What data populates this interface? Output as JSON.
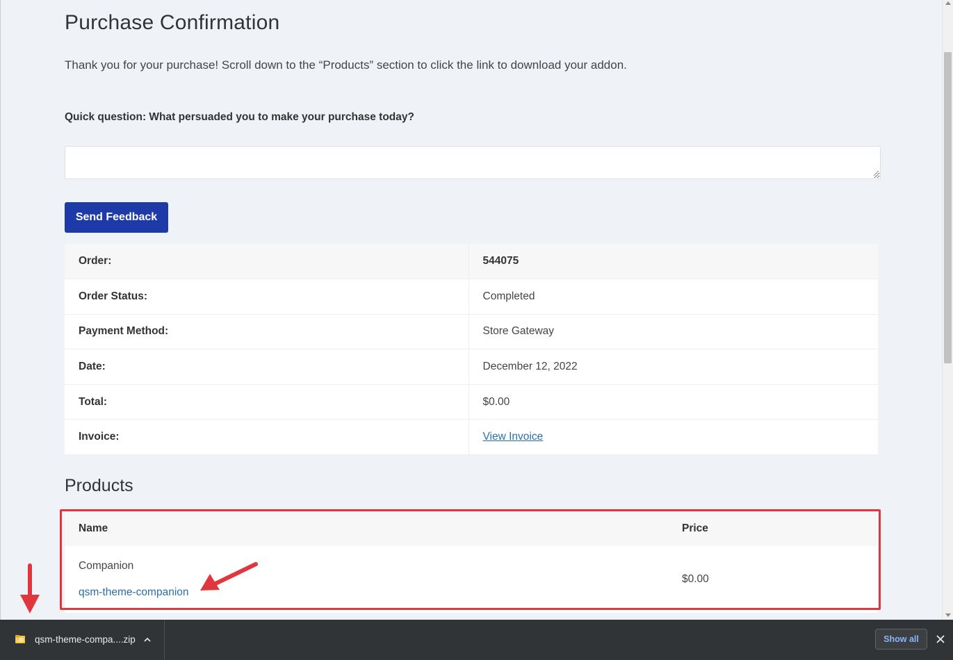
{
  "page": {
    "title": "Purchase Confirmation",
    "intro": "Thank you for your purchase! Scroll down to the “Products” section to click the link to download your addon.",
    "question": "Quick question: What persuaded you to make your purchase today?",
    "feedback_value": "",
    "send_button": "Send Feedback"
  },
  "order": {
    "rows": [
      {
        "label": "Order:",
        "value": "544075"
      },
      {
        "label": "Order Status:",
        "value": "Completed"
      },
      {
        "label": "Payment Method:",
        "value": "Store Gateway"
      },
      {
        "label": "Date:",
        "value": "December 12, 2022"
      },
      {
        "label": "Total:",
        "value": "$0.00"
      },
      {
        "label": "Invoice:",
        "value": "View Invoice"
      }
    ]
  },
  "products": {
    "heading": "Products",
    "columns": [
      "Name",
      "Price"
    ],
    "items": [
      {
        "name": "Companion",
        "link": "qsm-theme-companion",
        "price": "$0.00"
      }
    ]
  },
  "download_bar": {
    "filename": "qsm-theme-compa....zip",
    "show_all": "Show all",
    "file_icon": "zip-file-icon"
  },
  "colors": {
    "accent_button": "#1e3aa8",
    "link": "#2b6ea6",
    "annotation_red": "#e0373e",
    "page_bg": "#eff3f8",
    "download_bar_bg": "#313437"
  }
}
